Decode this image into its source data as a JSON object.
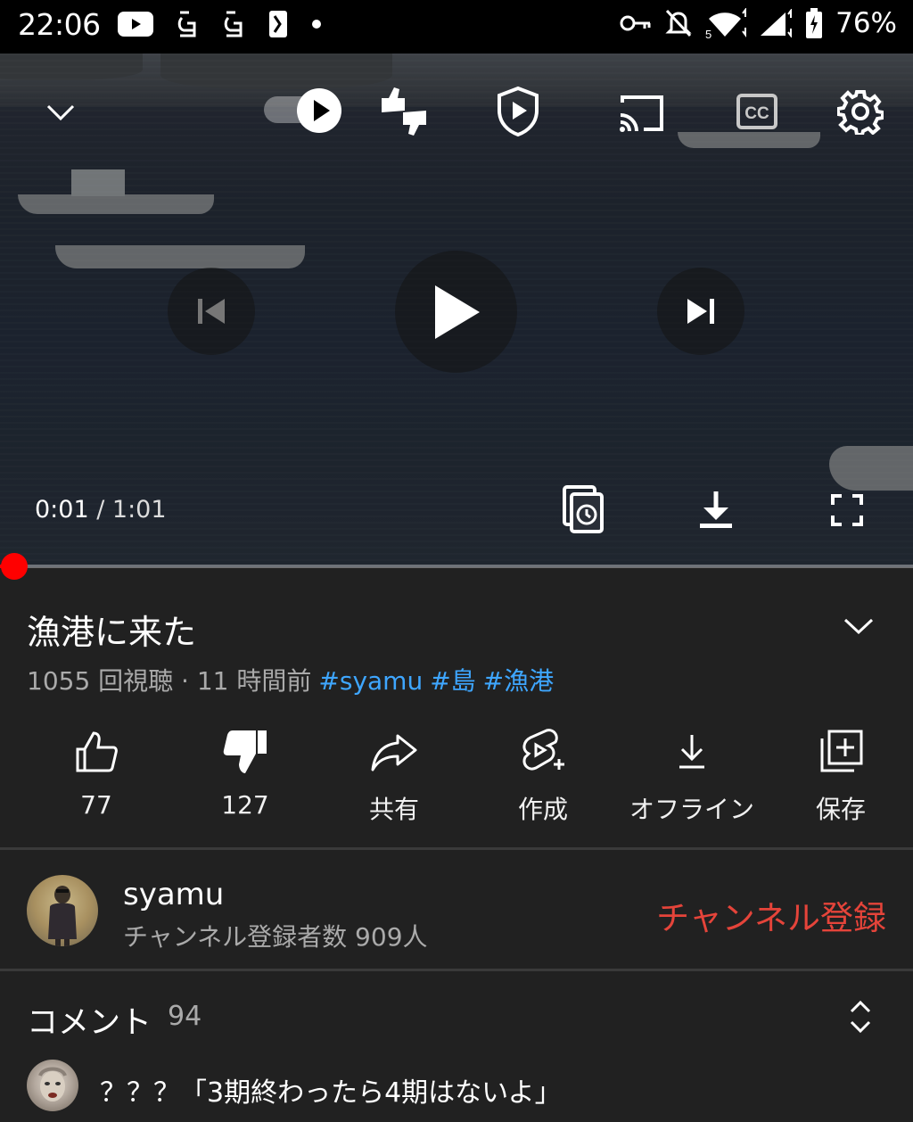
{
  "status_bar": {
    "time": "22:06",
    "battery": "76%",
    "left_icons": [
      "youtube-icon",
      "app-icon",
      "app-icon",
      "app-icon",
      "dot-icon"
    ],
    "right_icons": [
      "vpn-key-icon",
      "notifications-off-icon",
      "wifi-icon",
      "signal-icon",
      "battery-charging-icon"
    ],
    "wifi_badge": "5"
  },
  "player": {
    "current_time": "0:01",
    "separator": " / ",
    "duration": "1:01",
    "progress": 0.016,
    "cc_label": "CC",
    "top_icons": [
      "chevron-down-icon",
      "play-toggle-icon",
      "dislike-extension-icon",
      "shield-play-icon",
      "cast-icon",
      "cc-icon",
      "settings-icon"
    ],
    "center_icons": [
      "previous-icon",
      "play-icon",
      "next-icon"
    ],
    "bottom_icons": [
      "watch-later-icon",
      "download-icon",
      "fullscreen-icon"
    ]
  },
  "video": {
    "title": "漁港に来た",
    "meta": "1055 回視聴 · 11 時間前",
    "hashtags": [
      "#syamu",
      "#島",
      "#漁港"
    ]
  },
  "actions": [
    {
      "name": "like",
      "label": "77"
    },
    {
      "name": "dislike",
      "label": "127"
    },
    {
      "name": "share",
      "label": "共有"
    },
    {
      "name": "create",
      "label": "作成"
    },
    {
      "name": "offline",
      "label": "オフライン"
    },
    {
      "name": "save",
      "label": "保存"
    }
  ],
  "channel": {
    "name": "syamu",
    "subscribers": "チャンネル登録者数 909人",
    "subscribe_label": "チャンネル登録"
  },
  "comments": {
    "header": "コメント",
    "count": "94",
    "first_comment": "？？？「3期終わったら4期はないよ」"
  },
  "colors": {
    "background": "#212121",
    "accent_red": "#ff0000",
    "subscribe_red": "#e5443a",
    "hashtag_blue": "#3ea6ff"
  }
}
